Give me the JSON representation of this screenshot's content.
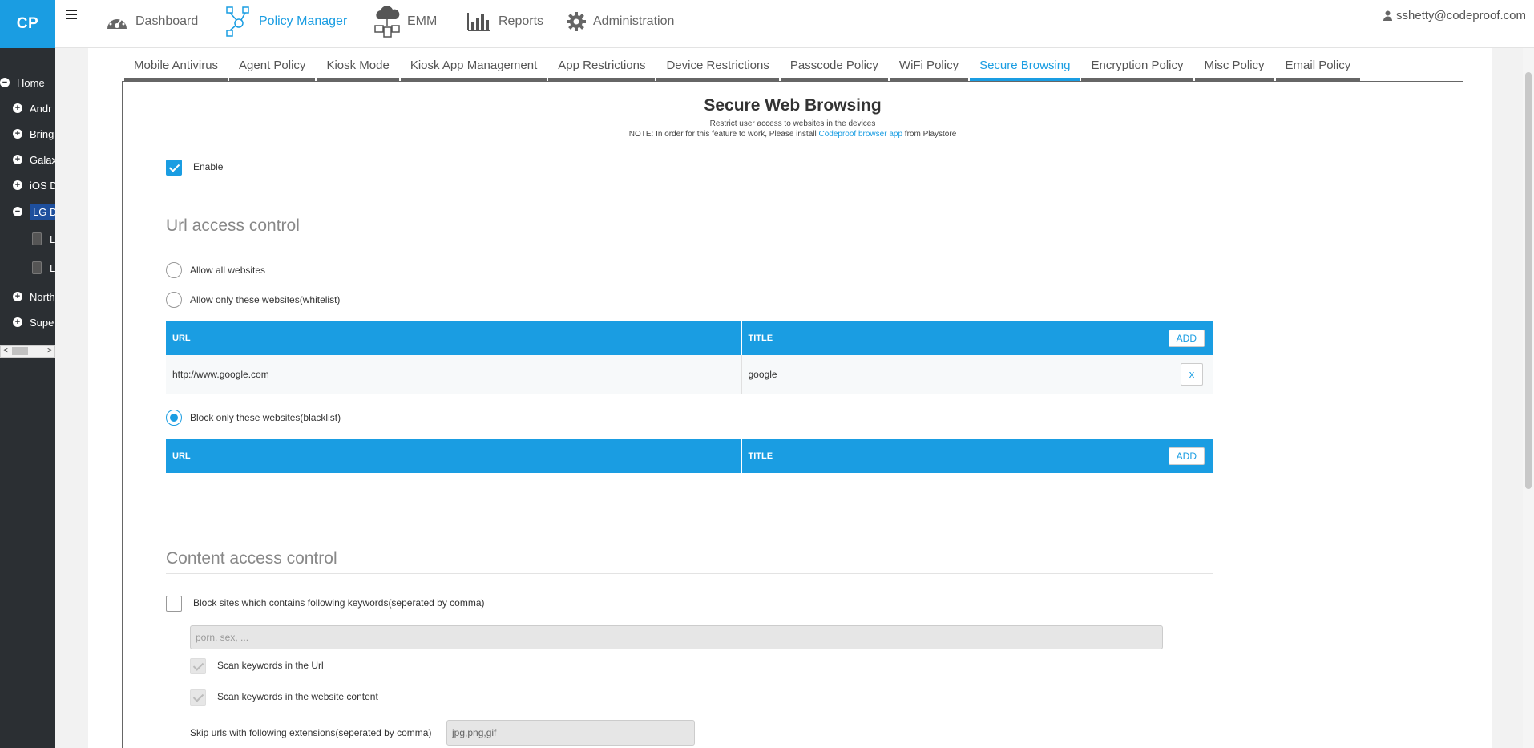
{
  "app": {
    "logo": "CP"
  },
  "nav": {
    "items": [
      {
        "label": "Dashboard"
      },
      {
        "label": "Policy Manager"
      },
      {
        "label": "EMM"
      },
      {
        "label": "Reports"
      },
      {
        "label": "Administration"
      }
    ],
    "user": "sshetty@codeproof.com"
  },
  "sidebar": {
    "items": [
      {
        "label": "Home",
        "state": "collapse"
      },
      {
        "label": "Andr",
        "state": "expand"
      },
      {
        "label": "Bring",
        "state": "expand"
      },
      {
        "label": "Galax",
        "state": "expand"
      },
      {
        "label": "iOS D",
        "state": "expand"
      },
      {
        "label": "LG D",
        "state": "collapse"
      },
      {
        "label": "L",
        "state": "device"
      },
      {
        "label": "L",
        "state": "device"
      },
      {
        "label": "North",
        "state": "expand"
      },
      {
        "label": "Supe",
        "state": "expand"
      }
    ]
  },
  "tabs": [
    "Mobile Antivirus",
    "Agent Policy",
    "Kiosk Mode",
    "Kiosk App Management",
    "App Restrictions",
    "Device Restrictions",
    "Passcode Policy",
    "WiFi Policy",
    "Secure Browsing",
    "Encryption Policy",
    "Misc Policy",
    "Email Policy"
  ],
  "page": {
    "title": "Secure Web Browsing",
    "subtitle": "Restrict user access to websites in the devices",
    "note_prefix": "NOTE: In order for this feature to work, Please install ",
    "note_link": "Codeproof browser app",
    "note_suffix": " from Playstore",
    "enable_label": "Enable"
  },
  "url_access": {
    "title": "Url access control",
    "allow_all": "Allow all websites",
    "whitelist_label": "Allow only these websites(whitelist)",
    "blacklist_label": "Block only these websites(blacklist)",
    "col_url": "URL",
    "col_title": "TITLE",
    "add_label": "ADD",
    "remove_label": "x",
    "whitelist_rows": [
      {
        "url": "http://www.google.com",
        "title": "google"
      }
    ]
  },
  "content_access": {
    "title": "Content access control",
    "keywords_label": "Block sites which contains following keywords(seperated by comma)",
    "keywords_placeholder": "porn, sex, ...",
    "scan_url_label": "Scan keywords in the Url",
    "scan_content_label": "Scan keywords in the website content",
    "skip_label": "Skip urls with following extensions(seperated by comma)",
    "skip_value": "jpg,png,gif"
  }
}
